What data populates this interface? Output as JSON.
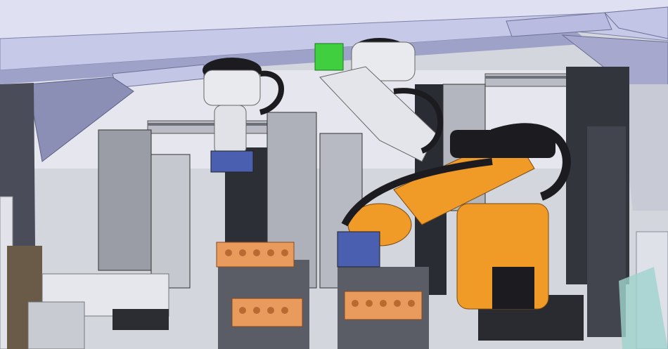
{
  "scene": {
    "kind": "cad-assembly-render",
    "colors": {
      "frame": "#c9cbe8",
      "frame_shadow": "#8f92b8",
      "floor": "#d3d6dc",
      "dark_panel": "#3a3c44",
      "aluminum": "#b8bcc4",
      "white_robot": "#e9eaee",
      "orange_robot": "#f09a28",
      "orange_parts": "#e89b5c",
      "black_cable": "#1c1c20",
      "blue_gripper": "#4a5fb0",
      "green_part": "#3fcf3f",
      "teal_part": "#5fb8b0"
    }
  }
}
